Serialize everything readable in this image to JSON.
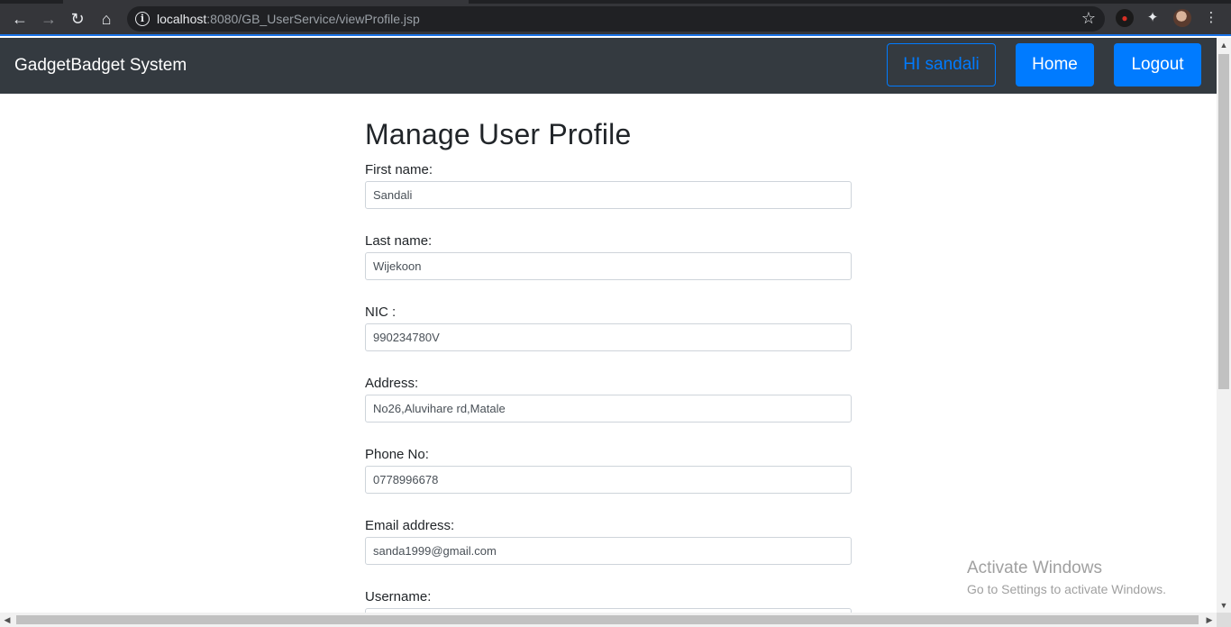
{
  "browser": {
    "url_host": "localhost",
    "url_path": ":8080/GB_UserService/viewProfile.jsp"
  },
  "navbar": {
    "brand": "GadgetBadget System",
    "greeting": "HI sandali",
    "home_label": "Home",
    "logout_label": "Logout"
  },
  "page": {
    "title": "Manage User Profile"
  },
  "form": {
    "fields": [
      {
        "label": "First name:",
        "value": "Sandali"
      },
      {
        "label": "Last name:",
        "value": "Wijekoon"
      },
      {
        "label": "NIC :",
        "value": "990234780V"
      },
      {
        "label": "Address:",
        "value": "No26,Aluvihare rd,Matale"
      },
      {
        "label": "Phone No:",
        "value": "0778996678"
      },
      {
        "label": "Email address:",
        "value": "sanda1999@gmail.com"
      },
      {
        "label": "Username:",
        "value": ""
      }
    ]
  },
  "watermark": {
    "line1": "Activate Windows",
    "line2": "Go to Settings to activate Windows."
  },
  "colors": {
    "navbar_bg": "#343a40",
    "primary": "#007bff"
  }
}
